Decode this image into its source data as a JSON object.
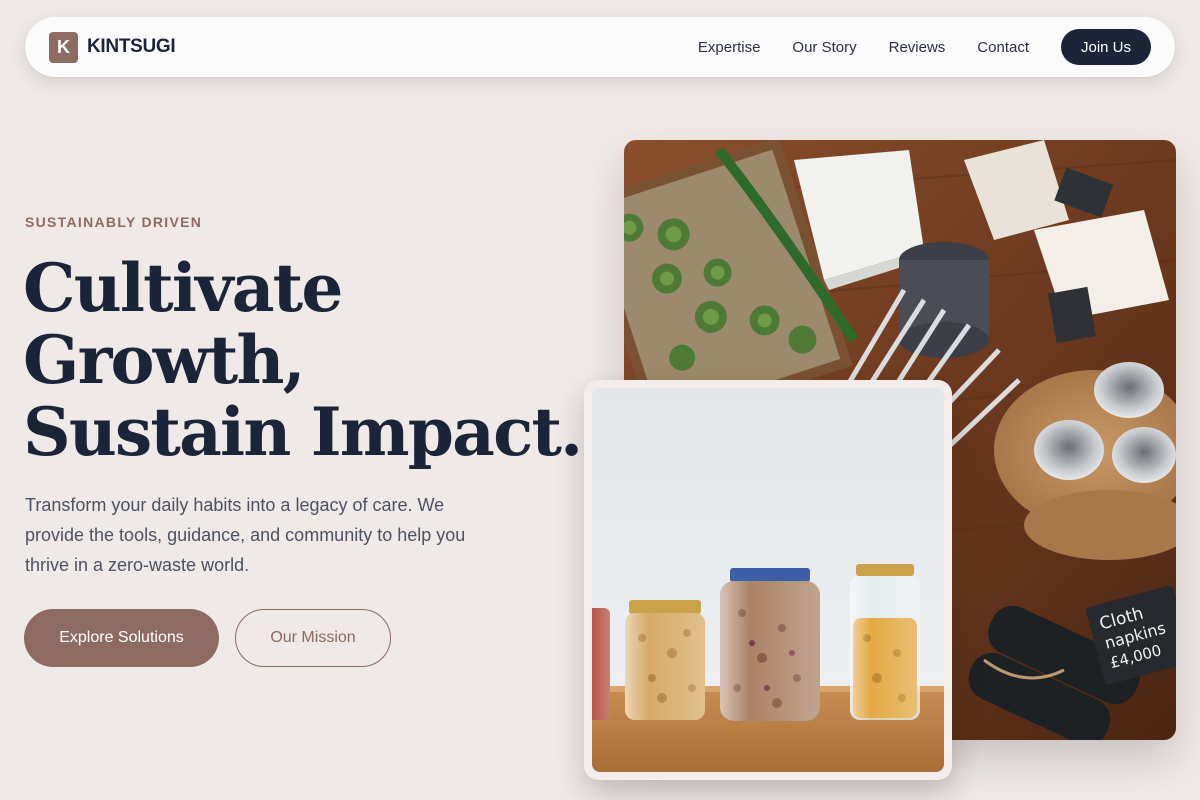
{
  "brand": {
    "mark": "K",
    "name": "KINTSUGI"
  },
  "nav": {
    "links": [
      "Expertise",
      "Our Story",
      "Reviews",
      "Contact"
    ],
    "cta": "Join Us"
  },
  "hero": {
    "eyebrow": "SUSTAINABLY DRIVEN",
    "headline": [
      "Cultivate",
      "Growth,",
      "Sustain Impact."
    ],
    "lead": "Transform your daily habits into a legacy of care. We provide the tools, guidance, and community to help you thrive in a zero-waste world.",
    "primary_cta": "Explore Solutions",
    "secondary_cta": "Our Mission"
  },
  "images": {
    "back_label_1": "Cloth",
    "back_label_2": "napkins",
    "back_label_3": "£4,000"
  },
  "colors": {
    "background": "#efe9e7",
    "accent": "#8d6b62",
    "navy": "#1c2438"
  }
}
